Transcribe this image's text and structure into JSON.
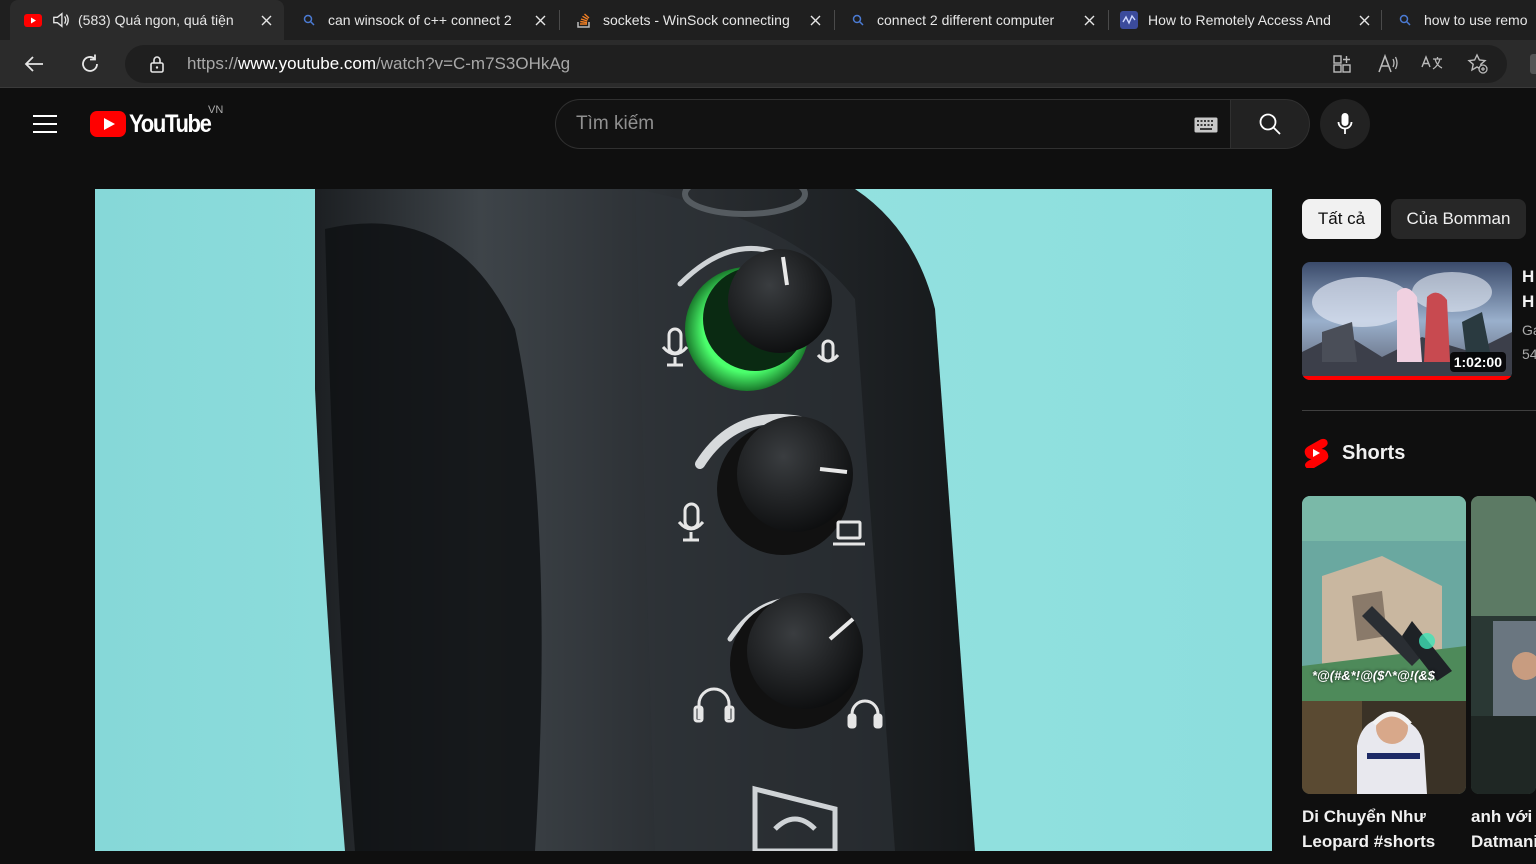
{
  "browser": {
    "tabs": [
      {
        "title": "(583) Quá ngon, quá tiện",
        "icon": "youtube-icon",
        "active": true
      },
      {
        "title": "can winsock of c++ connect 2",
        "icon": "search-icon",
        "active": false
      },
      {
        "title": "sockets - WinSock connecting",
        "icon": "stackoverflow-icon",
        "active": false
      },
      {
        "title": "connect 2 different computer",
        "icon": "search-icon",
        "active": false
      },
      {
        "title": "How to Remotely Access And",
        "icon": "site-icon",
        "active": false
      },
      {
        "title": "how to use remo",
        "icon": "search-icon",
        "active": false
      }
    ],
    "address": {
      "scheme": "https://",
      "host": "www.youtube.com",
      "path": "/watch?v=C-m7S3OHkAg"
    }
  },
  "youtube": {
    "logo_text": "YouTube",
    "country_code": "VN",
    "search_placeholder": "Tìm kiếm",
    "chips": [
      {
        "label": "Tất cả",
        "selected": true
      },
      {
        "label": "Của Bomman",
        "selected": false
      }
    ],
    "recommended": {
      "duration": "1:02:00",
      "watched_fraction": 1.0,
      "title_line1": "H",
      "title_line2": "H",
      "meta_line1": "Ga",
      "meta_line2": "54"
    },
    "shorts_label": "Shorts",
    "shorts": [
      {
        "title_line1": "Di Chuyển Như",
        "title_line2": "Leopard #shorts",
        "caption": "*@(#&*!@($^*@!(&$"
      },
      {
        "title_line1": "anh với",
        "title_line2": "Datmani",
        "caption": ""
      }
    ]
  },
  "colors": {
    "youtube_red": "#ff0000",
    "background": "#0f0f0f",
    "knob_glow": "#33e05a"
  }
}
